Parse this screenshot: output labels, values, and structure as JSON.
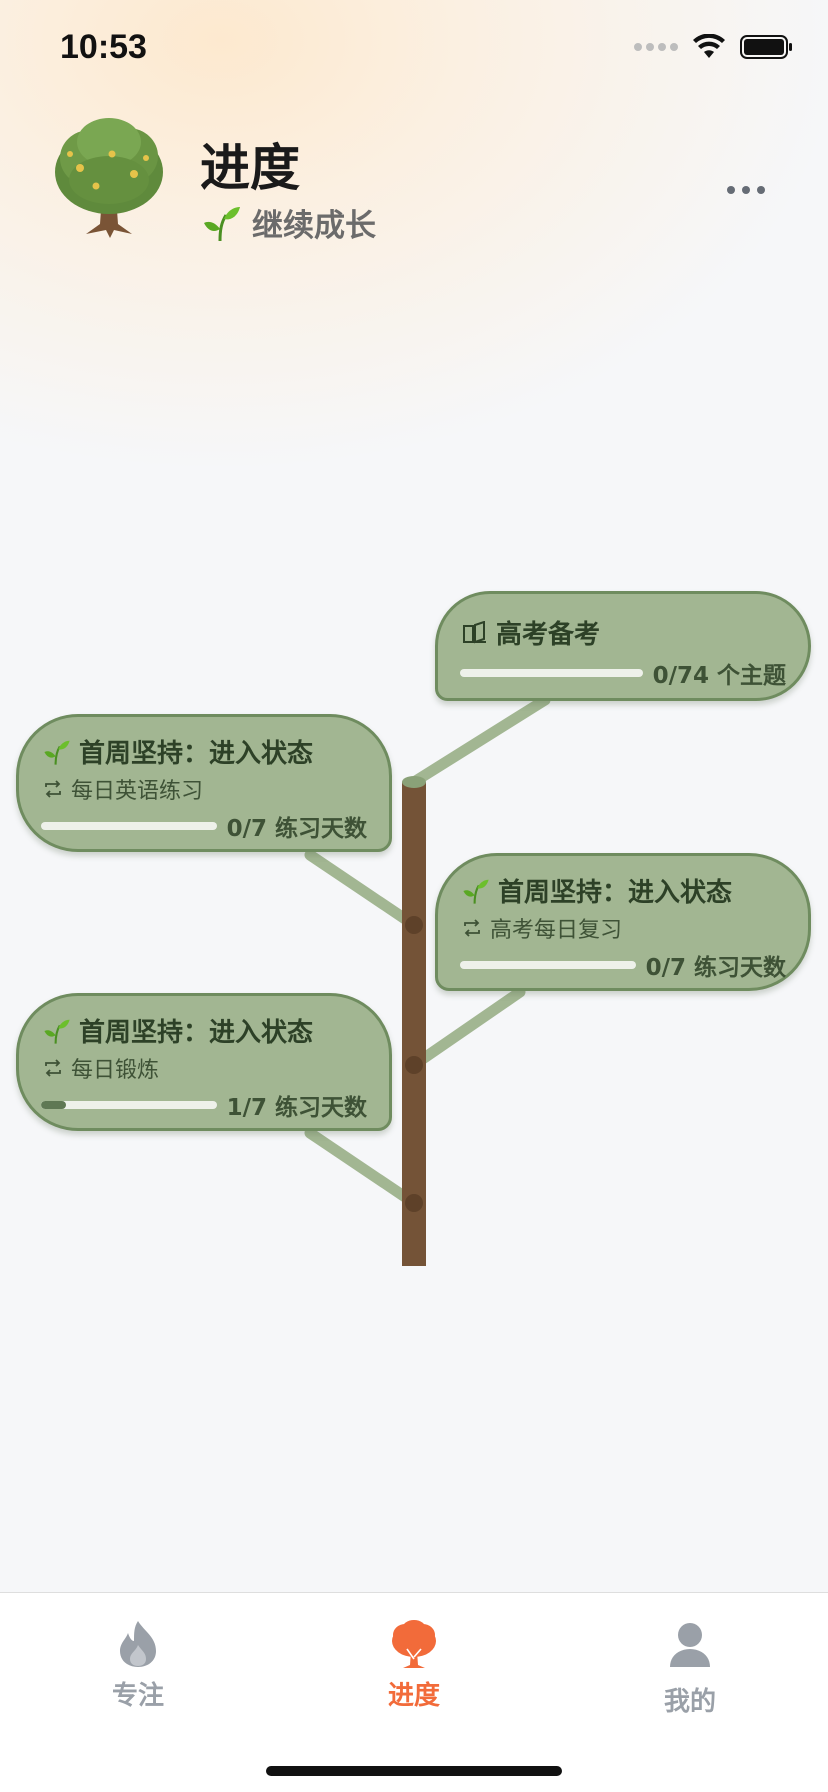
{
  "status_bar": {
    "time": "10:53"
  },
  "header": {
    "title": "进度",
    "subtitle": "继续成长"
  },
  "goals": [
    {
      "title": "高考备考",
      "subtitle": "",
      "count": "0/74 个主题",
      "progress": 0,
      "icon": "book-icon"
    },
    {
      "title": "首周坚持：进入状态",
      "subtitle": "每日英语练习",
      "count": "0/7 练习天数",
      "progress": 0,
      "icon": "sprout-icon"
    },
    {
      "title": "首周坚持：进入状态",
      "subtitle": "高考每日复习",
      "count": "0/7 练习天数",
      "progress": 0,
      "icon": "sprout-icon"
    },
    {
      "title": "首周坚持：进入状态",
      "subtitle": "每日锻炼",
      "count": "1/7 练习天数",
      "progress": 0.14,
      "icon": "sprout-icon"
    }
  ],
  "tabs": [
    {
      "label": "专注",
      "icon": "flame-icon",
      "active": false
    },
    {
      "label": "进度",
      "icon": "tree-icon",
      "active": true
    },
    {
      "label": "我的",
      "icon": "person-icon",
      "active": false
    }
  ],
  "colors": {
    "accent": "#f26b3a",
    "inactive": "#9aa0a8",
    "leaf": "#a2b692",
    "leaf_border": "#6f8c5f",
    "trunk": "#745337"
  }
}
